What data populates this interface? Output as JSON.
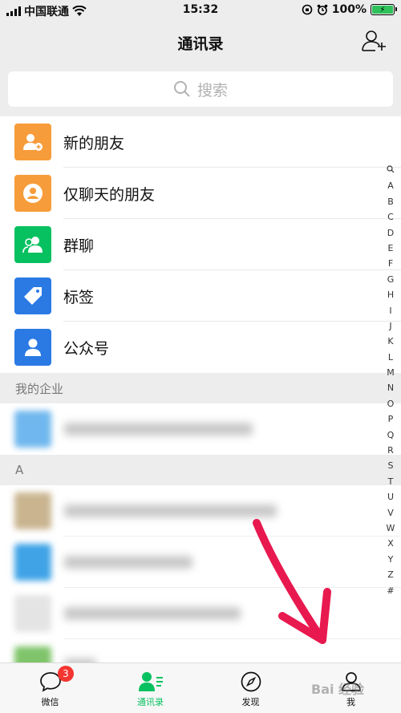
{
  "status": {
    "carrier": "中国联通",
    "time": "15:32",
    "battery": "100%"
  },
  "header": {
    "title": "通讯录"
  },
  "search": {
    "placeholder": "搜索"
  },
  "menu": [
    {
      "label": "新的朋友",
      "color": "#f79c3a",
      "icon": "add-friend-icon"
    },
    {
      "label": "仅聊天的朋友",
      "color": "#f79c3a",
      "icon": "person-icon"
    },
    {
      "label": "群聊",
      "color": "#07c160",
      "icon": "group-icon"
    },
    {
      "label": "标签",
      "color": "#2b7ae4",
      "icon": "tag-icon"
    },
    {
      "label": "公众号",
      "color": "#2b7ae4",
      "icon": "official-account-icon"
    }
  ],
  "sections": {
    "enterprise": "我的企业",
    "a": "A"
  },
  "index": [
    "A",
    "B",
    "C",
    "D",
    "E",
    "F",
    "G",
    "H",
    "I",
    "J",
    "K",
    "L",
    "M",
    "N",
    "O",
    "P",
    "Q",
    "R",
    "S",
    "T",
    "U",
    "V",
    "W",
    "X",
    "Y",
    "Z",
    "#"
  ],
  "tabs": [
    {
      "label": "微信",
      "badge": "3"
    },
    {
      "label": "通讯录"
    },
    {
      "label": "发现"
    },
    {
      "label": "我"
    }
  ],
  "colors": {
    "accent": "#07c160",
    "badge": "#f43530",
    "arrow": "#e8194f"
  },
  "watermark": "Bai 经验"
}
